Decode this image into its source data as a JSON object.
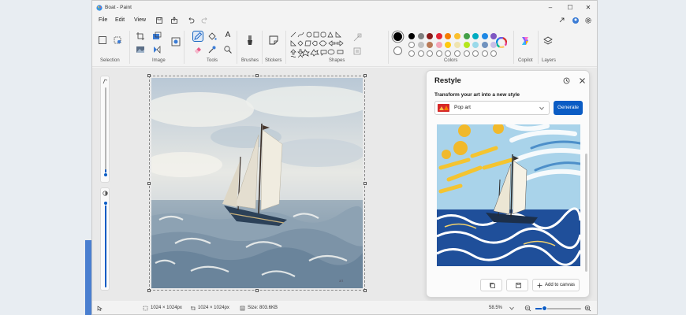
{
  "window": {
    "title": "Boat - Paint",
    "controls": {
      "minimize": "–",
      "maximize": "☐",
      "close": "✕"
    }
  },
  "menu": {
    "file": "File",
    "edit": "Edit",
    "view": "View"
  },
  "ribbon": {
    "groups": {
      "selection": "Selection",
      "image": "Image",
      "tools": "Tools",
      "brushes": "Brushes",
      "stickers": "Stickers",
      "shapes": "Shapes",
      "colors": "Colors",
      "copilot": "Copilot",
      "layers": "Layers"
    },
    "text_tool": "A",
    "palette_row1": [
      "#000000",
      "#7f7f7f",
      "#8b1a1a",
      "#e32636",
      "#f57c00",
      "#fbc02d",
      "#43a047",
      "#00acc1",
      "#1e88e5",
      "#7e57c2"
    ],
    "palette_row2": [
      "#ffffff",
      "#c3c3c3",
      "#b97a57",
      "#f4a6b7",
      "#ffc90e",
      "#efe4b0",
      "#b5e61d",
      "#99d9ea",
      "#7092be",
      "#c8bfe7"
    ]
  },
  "restyle": {
    "title": "Restyle",
    "subtitle": "Transform your art into a new style",
    "style_value": "Pop art",
    "generate_label": "Generate",
    "add_to_canvas_label": "Add to canvas"
  },
  "status": {
    "selection_size": "1024 × 1024px",
    "canvas_size": "1024 × 1024px",
    "file_size": "Size: 803.6KB",
    "zoom": "58.5%",
    "zoom_level": 0.2
  },
  "accent_color": "#0b5cc4"
}
